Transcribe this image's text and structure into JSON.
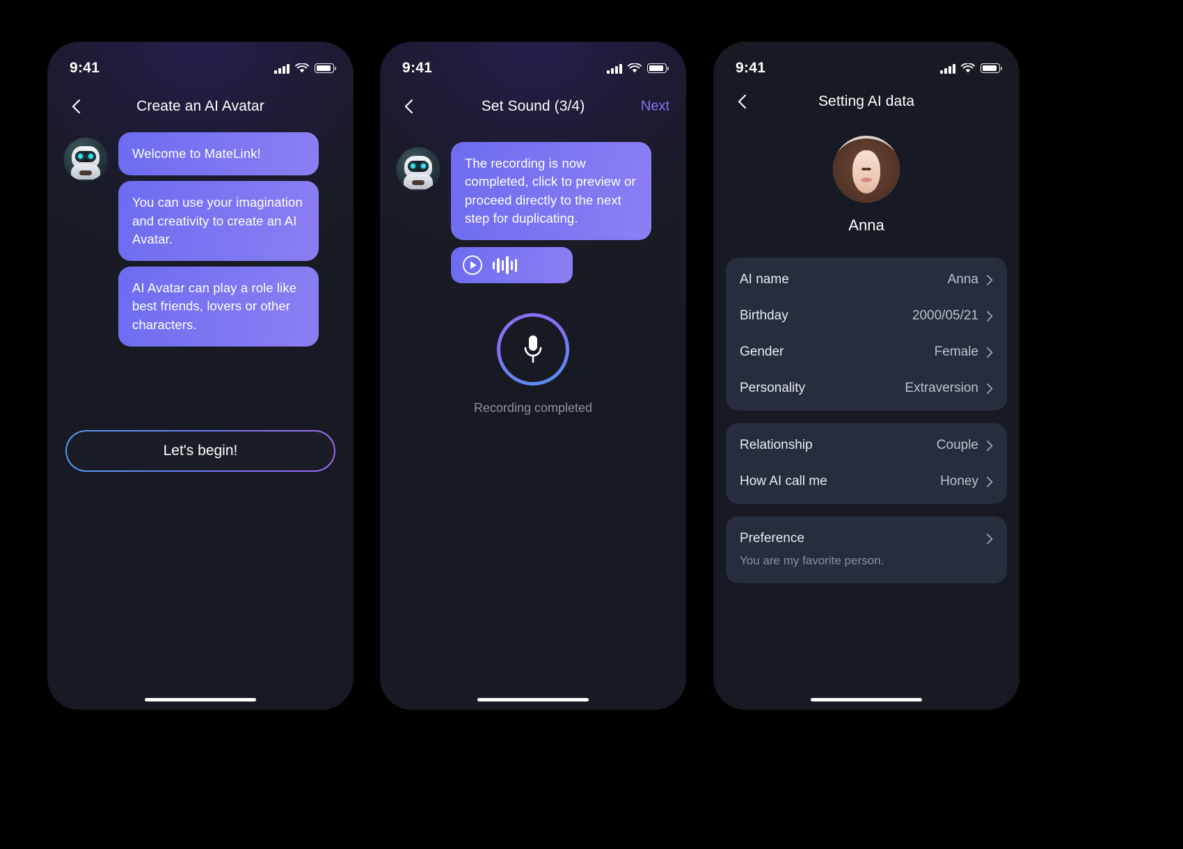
{
  "screens": [
    {
      "id": "create-ai-avatar",
      "status": {
        "time": "9:41"
      },
      "nav": {
        "title": "Create an AI Avatar",
        "back_icon": "chevron-left-icon"
      },
      "bubbles": [
        "Welcome to MateLink!",
        "You can use your imagination and creativity to create an AI Avatar.",
        "AI Avatar can play a role like best friends, lovers or other characters."
      ],
      "primary_button": "Let's begin!"
    },
    {
      "id": "set-sound",
      "status": {
        "time": "9:41"
      },
      "nav": {
        "title": "Set Sound (3/4)",
        "back_icon": "chevron-left-icon",
        "action": "Next"
      },
      "bubbles": [
        "The recording is now completed, click to preview or proceed directly to the next step for duplicating."
      ],
      "audio_player": {
        "play_icon": "play-circle-icon",
        "waveform_icon": "waveform-icon"
      },
      "mic": {
        "icon": "microphone-icon",
        "caption": "Recording completed"
      }
    },
    {
      "id": "setting-ai-data",
      "status": {
        "time": "9:41"
      },
      "nav": {
        "title": "Setting AI data",
        "back_icon": "chevron-left-icon"
      },
      "profile": {
        "name": "Anna",
        "avatar_icon": "user-photo-avatar"
      },
      "cards": [
        {
          "rows": [
            {
              "label": "AI name",
              "value": "Anna"
            },
            {
              "label": "Birthday",
              "value": "2000/05/21"
            },
            {
              "label": "Gender",
              "value": "Female"
            },
            {
              "label": "Personality",
              "value": "Extraversion"
            }
          ]
        },
        {
          "rows": [
            {
              "label": "Relationship",
              "value": "Couple"
            },
            {
              "label": "How AI call me",
              "value": "Honey"
            }
          ]
        },
        {
          "rows": [
            {
              "label": "Preference",
              "value": ""
            }
          ],
          "description": "You are my favorite person."
        }
      ]
    }
  ],
  "colors": {
    "background": "#000000",
    "phone_surface": "#171a23",
    "card_surface": "#262d3c",
    "bubble_from": "#6d6cf0",
    "bubble_to": "#8b7ff2",
    "accent_link": "#7b79ef",
    "muted_text": "#8b90a0",
    "value_text": "#b9c0ce"
  }
}
